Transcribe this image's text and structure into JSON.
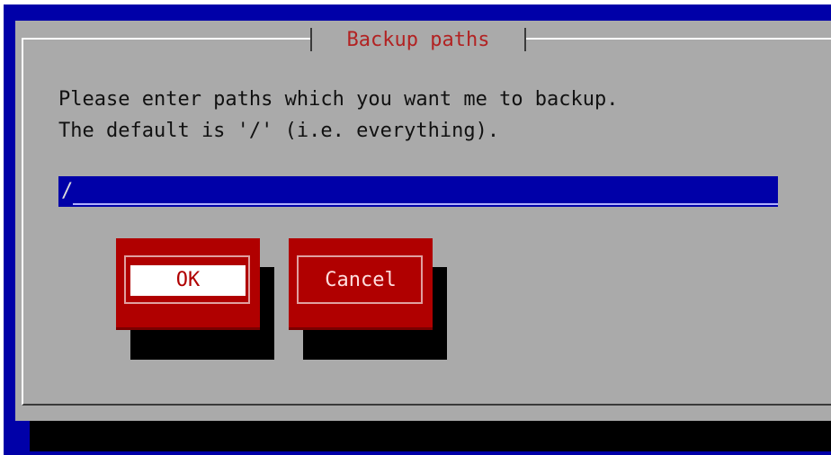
{
  "dialog": {
    "title": "Backup paths",
    "message_line1": "Please enter paths which you want me to backup.",
    "message_line2": "The default is '/' (i.e. everything).",
    "input_value": "/"
  },
  "buttons": {
    "ok_label": "OK",
    "cancel_label": "Cancel"
  },
  "colors": {
    "screen_background": "#0000a8",
    "dialog_background": "#aaaaaa",
    "title_text": "#b22222",
    "button_background": "#b00000",
    "input_background": "#0000a8"
  }
}
